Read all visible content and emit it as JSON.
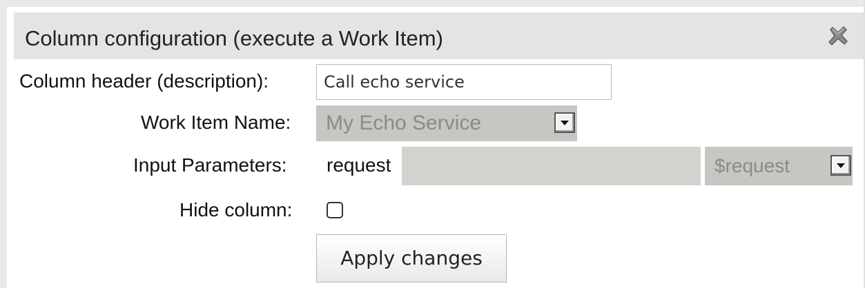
{
  "dialog": {
    "title": "Column configuration (execute a Work Item)",
    "close_icon": "close-x-icon"
  },
  "form": {
    "column_header": {
      "label": "Column header (description):",
      "value": "Call echo service"
    },
    "work_item_name": {
      "label": "Work Item Name:",
      "selected": "My Echo Service"
    },
    "input_parameters": {
      "label": "Input Parameters:",
      "param_name": "request",
      "param_value": "",
      "mapping_selected": "$request"
    },
    "hide_column": {
      "label": "Hide column:",
      "checked": false
    },
    "apply_button": "Apply changes"
  },
  "colors": {
    "title_bar": "#e4e4e4",
    "disabled_select": "#c8c6c2",
    "disabled_text": "#8a8a8a"
  }
}
